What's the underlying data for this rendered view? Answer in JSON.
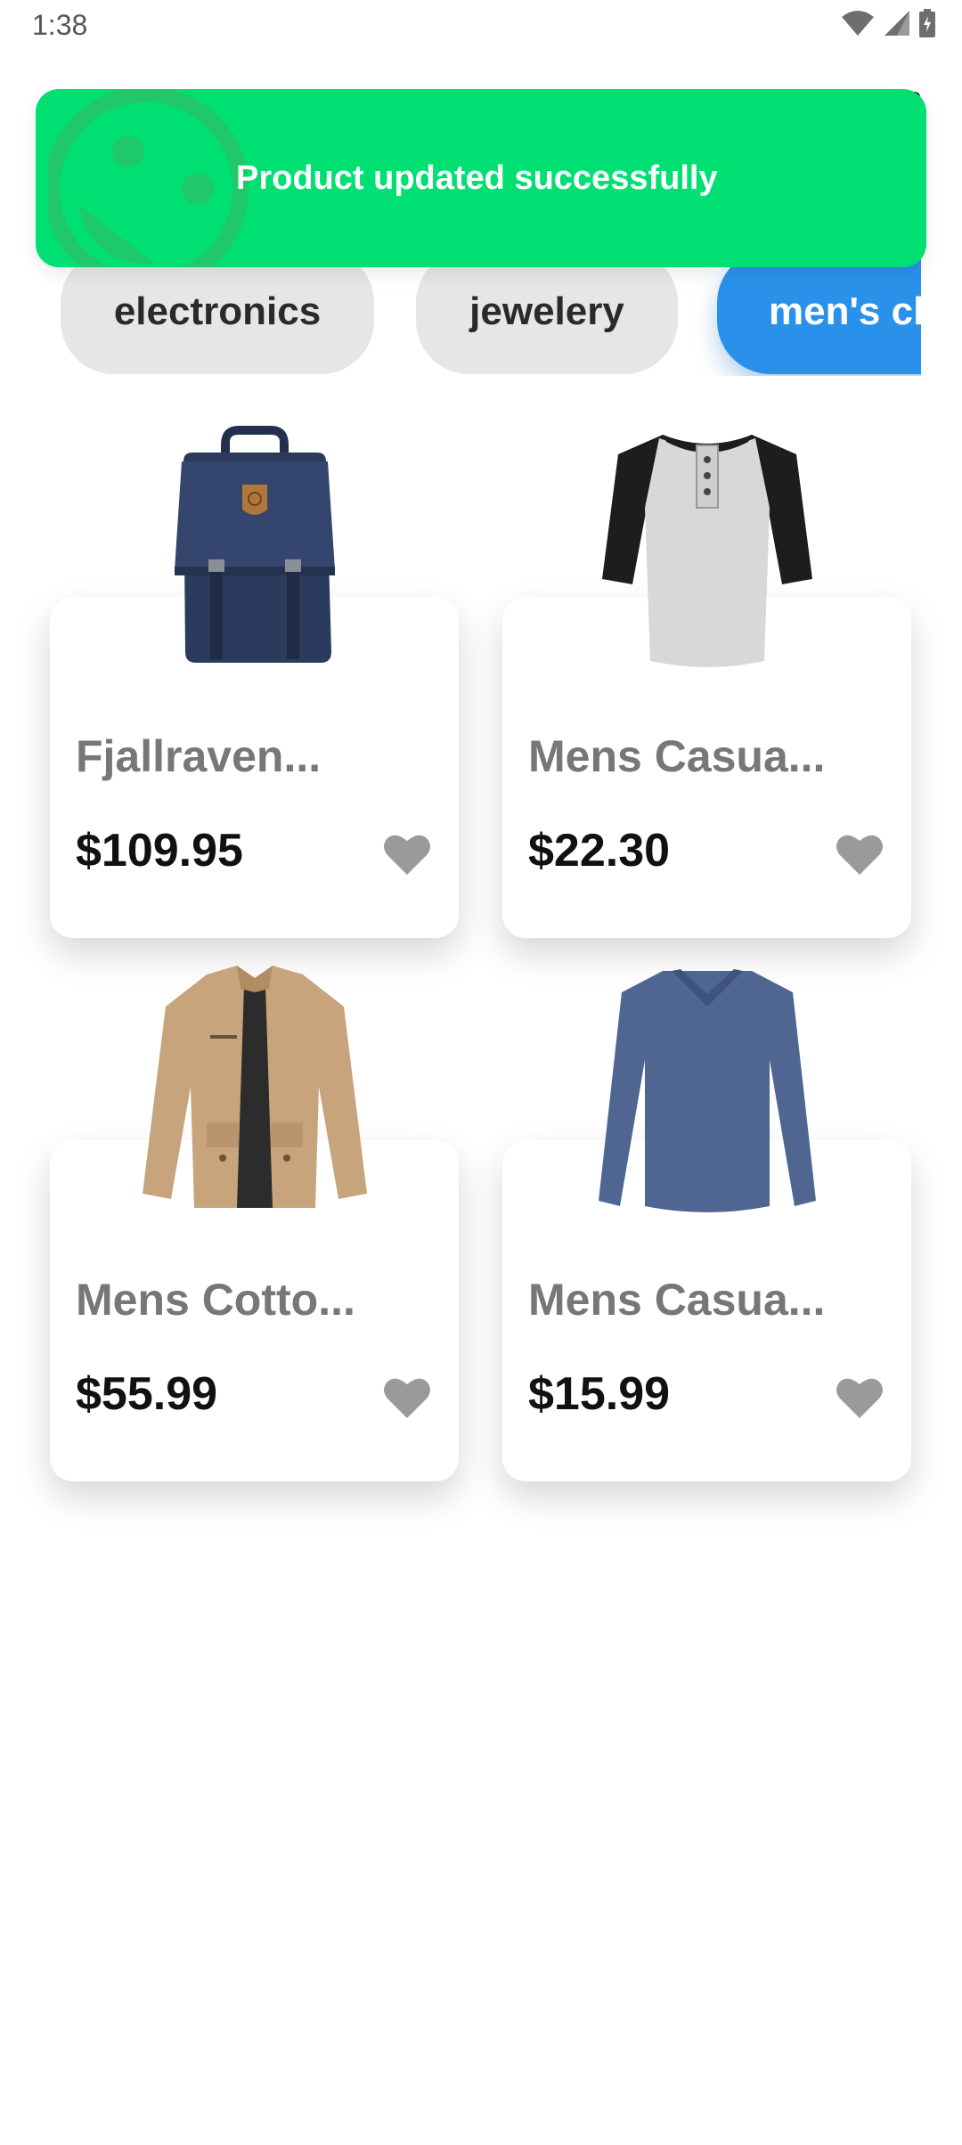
{
  "status_bar": {
    "time": "1:38",
    "icons": [
      "wifi-icon",
      "signal-icon",
      "battery-icon"
    ]
  },
  "header": {
    "cart_icon": "bag-icon"
  },
  "toast": {
    "message": "Product updated successfully",
    "color": "#00e072",
    "icon": "smiley-face-icon"
  },
  "categories": [
    {
      "label": "electronics",
      "active": false
    },
    {
      "label": "jewelery",
      "active": false
    },
    {
      "label": "men's cl",
      "active": true
    }
  ],
  "accent_color": "#2a91ea",
  "products": [
    {
      "name": "Fjallraven...",
      "price": "$109.95",
      "image": "backpack",
      "favorite_icon": "heart-icon"
    },
    {
      "name": "Mens Casua...",
      "price": "$22.30",
      "image": "raglan-tshirt",
      "favorite_icon": "heart-icon"
    },
    {
      "name": "Mens Cotto...",
      "price": "$55.99",
      "image": "jacket",
      "favorite_icon": "heart-icon"
    },
    {
      "name": "Mens Casua...",
      "price": "$15.99",
      "image": "long-sleeve-shirt",
      "favorite_icon": "heart-icon"
    }
  ]
}
